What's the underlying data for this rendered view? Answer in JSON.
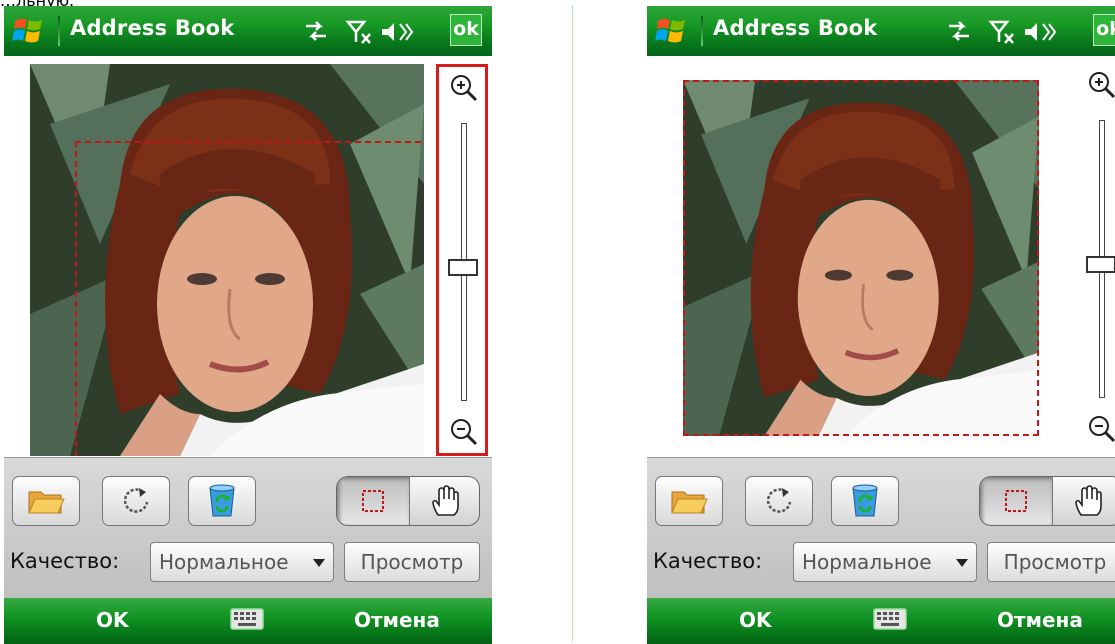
{
  "caption_fragment": "…льную.",
  "screens": [
    {
      "title": "Address Book",
      "ok_label": "ok",
      "zoom_level": 0.52,
      "selection_highlighted": true,
      "toolbar": {
        "open_icon": "folder-icon",
        "rotate_icon": "rotate-icon",
        "clear_icon": "recycle-bin-icon",
        "crop_tool_icon": "crop-selection-icon",
        "pan_tool_icon": "hand-icon"
      },
      "quality_label": "Качество:",
      "quality_value": "Нормальное",
      "preview_label": "Просмотр",
      "softkey_left": "OK",
      "softkey_right": "Отмена"
    },
    {
      "title": "Address Book",
      "ok_label": "ok",
      "zoom_level": 0.52,
      "selection_highlighted": false,
      "toolbar": {
        "open_icon": "folder-icon",
        "rotate_icon": "rotate-icon",
        "clear_icon": "recycle-bin-icon",
        "crop_tool_icon": "crop-selection-icon",
        "pan_tool_icon": "hand-icon"
      },
      "quality_label": "Качество:",
      "quality_value": "Нормальное",
      "preview_label": "Просмотр",
      "softkey_left": "OK",
      "softkey_right": "Отмена"
    }
  ],
  "colors": {
    "titlebar_green": "#189a26",
    "selection_red": "#c01818",
    "highlight_red": "#d51d1d"
  }
}
